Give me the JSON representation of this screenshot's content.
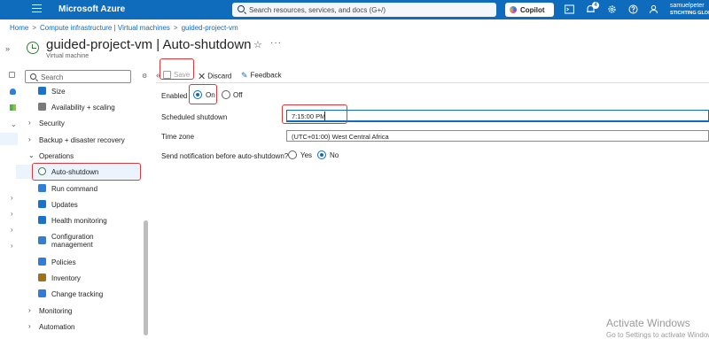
{
  "topbar": {
    "brand": "Microsoft Azure",
    "search_placeholder": "Search resources, services, and docs (G+/)",
    "copilot_label": "Copilot",
    "notification_count": "4",
    "account_name": "samuelpeter",
    "account_org": "STICHTING GLOB",
    "icons": [
      "hamburger-icon",
      "search-icon",
      "copilot-icon",
      "cloud-shell-icon",
      "bell-icon",
      "gear-icon",
      "help-icon",
      "person-feedback-icon"
    ]
  },
  "breadcrumb": [
    "Home",
    "Compute infrastructure | Virtual machines",
    "guided-project-vm"
  ],
  "header": {
    "title": "guided-project-vm | Auto-shutdown",
    "subtitle": "Virtual machine"
  },
  "menu": {
    "search_placeholder": "Search",
    "items": [
      {
        "label": "Size",
        "kind": "child",
        "icon": "size-icon",
        "color": "#1a73c9"
      },
      {
        "label": "Availability + scaling",
        "kind": "child",
        "icon": "availability-icon",
        "color": "#7a7a7a"
      },
      {
        "label": "Security",
        "kind": "group"
      },
      {
        "label": "Backup + disaster recovery",
        "kind": "group"
      },
      {
        "label": "Operations",
        "kind": "group-open"
      },
      {
        "label": "Auto-shutdown",
        "kind": "child",
        "icon": "clock-icon",
        "color": "#3b7a3b",
        "active": true
      },
      {
        "label": "Run command",
        "kind": "child",
        "icon": "run-command-icon",
        "color": "#2f7fd8"
      },
      {
        "label": "Updates",
        "kind": "child",
        "icon": "updates-icon",
        "color": "#1a73c9"
      },
      {
        "label": "Health monitoring",
        "kind": "child",
        "icon": "health-icon",
        "color": "#1a73c9"
      },
      {
        "label": "Configuration management",
        "kind": "child",
        "icon": "configuration-icon",
        "color": "#2f7fd8"
      },
      {
        "label": "Policies",
        "kind": "child",
        "icon": "policies-icon",
        "color": "#2f7fd8"
      },
      {
        "label": "Inventory",
        "kind": "child",
        "icon": "inventory-icon",
        "color": "#a0701b"
      },
      {
        "label": "Change tracking",
        "kind": "child",
        "icon": "change-tracking-icon",
        "color": "#2f7fd8"
      },
      {
        "label": "Monitoring",
        "kind": "group"
      },
      {
        "label": "Automation",
        "kind": "group"
      }
    ]
  },
  "commands": {
    "save": "Save",
    "discard": "Discard",
    "feedback": "Feedback"
  },
  "form": {
    "enabled_label": "Enabled",
    "enabled_on": "On",
    "enabled_off": "Off",
    "enabled_value": "On",
    "scheduled_label": "Scheduled shutdown",
    "scheduled_value": "7:15:00 PM",
    "timezone_label": "Time zone",
    "timezone_value": "(UTC+01:00) West Central Africa",
    "notify_label": "Send notification before auto-shutdown?",
    "notify_yes": "Yes",
    "notify_no": "No",
    "notify_value": "No"
  },
  "watermark": {
    "title": "Activate Windows",
    "subtitle": "Go to Settings to activate Windows."
  },
  "colors": {
    "azure_blue": "#0f6cbd",
    "highlight_red": "#e0373b"
  }
}
